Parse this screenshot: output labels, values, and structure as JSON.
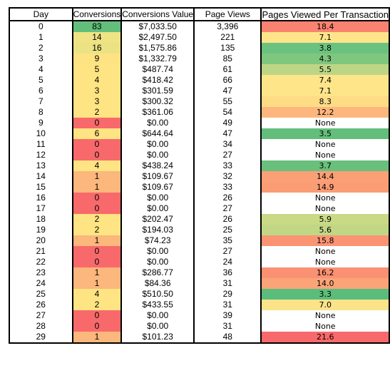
{
  "table": {
    "headers": {
      "day": "Day",
      "conversions": "Conversions",
      "conversions_value": "Conversions Value",
      "page_views": "Page Views",
      "pages_per_transaction": "Pages Viewed Per Transaction"
    },
    "rows": [
      {
        "day": "0",
        "conversions": "83",
        "conversions_value": "$7,033.50",
        "page_views": "3,396",
        "pages_per_transaction": "18.4",
        "conv_color": "#63be7b",
        "ppt_color": "#f98370"
      },
      {
        "day": "1",
        "conversions": "14",
        "conversions_value": "$2,497.50",
        "page_views": "221",
        "pages_per_transaction": "7.1",
        "conv_color": "#efe383",
        "ppt_color": "#ffe58a"
      },
      {
        "day": "2",
        "conversions": "16",
        "conversions_value": "$1,575.86",
        "page_views": "135",
        "pages_per_transaction": "3.8",
        "conv_color": "#ebe283",
        "ppt_color": "#6bc27e"
      },
      {
        "day": "3",
        "conversions": "9",
        "conversions_value": "$1,332.79",
        "page_views": "85",
        "pages_per_transaction": "4.3",
        "conv_color": "#fee383",
        "ppt_color": "#7fc67f"
      },
      {
        "day": "4",
        "conversions": "5",
        "conversions_value": "$487.74",
        "page_views": "61",
        "pages_per_transaction": "5.5",
        "conv_color": "#fee482",
        "ppt_color": "#bcd686"
      },
      {
        "day": "5",
        "conversions": "4",
        "conversions_value": "$418.42",
        "page_views": "66",
        "pages_per_transaction": "7.4",
        "conv_color": "#fee482",
        "ppt_color": "#ffe58a"
      },
      {
        "day": "6",
        "conversions": "3",
        "conversions_value": "$301.59",
        "page_views": "47",
        "pages_per_transaction": "7.1",
        "conv_color": "#fee482",
        "ppt_color": "#ffe58a"
      },
      {
        "day": "7",
        "conversions": "3",
        "conversions_value": "$300.32",
        "page_views": "55",
        "pages_per_transaction": "8.3",
        "conv_color": "#fee482",
        "ppt_color": "#fedc86"
      },
      {
        "day": "8",
        "conversions": "2",
        "conversions_value": "$361.06",
        "page_views": "54",
        "pages_per_transaction": "12.2",
        "conv_color": "#fee482",
        "ppt_color": "#fdb77e"
      },
      {
        "day": "9",
        "conversions": "0",
        "conversions_value": "$0.00",
        "page_views": "49",
        "pages_per_transaction": "None",
        "conv_color": "#f8696b",
        "ppt_color": "#ffffff"
      },
      {
        "day": "10",
        "conversions": "6",
        "conversions_value": "$644.64",
        "page_views": "47",
        "pages_per_transaction": "3.5",
        "conv_color": "#fee482",
        "ppt_color": "#63be7b"
      },
      {
        "day": "11",
        "conversions": "0",
        "conversions_value": "$0.00",
        "page_views": "34",
        "pages_per_transaction": "None",
        "conv_color": "#f8696b",
        "ppt_color": "#ffffff"
      },
      {
        "day": "12",
        "conversions": "0",
        "conversions_value": "$0.00",
        "page_views": "27",
        "pages_per_transaction": "None",
        "conv_color": "#f8696b",
        "ppt_color": "#ffffff"
      },
      {
        "day": "13",
        "conversions": "4",
        "conversions_value": "$438.24",
        "page_views": "33",
        "pages_per_transaction": "3.7",
        "conv_color": "#fee482",
        "ppt_color": "#69c07c"
      },
      {
        "day": "14",
        "conversions": "1",
        "conversions_value": "$109.67",
        "page_views": "32",
        "pages_per_transaction": "14.4",
        "conv_color": "#fbb77c",
        "ppt_color": "#fba076"
      },
      {
        "day": "15",
        "conversions": "1",
        "conversions_value": "$109.67",
        "page_views": "33",
        "pages_per_transaction": "14.9",
        "conv_color": "#fbb77c",
        "ppt_color": "#fb9c75"
      },
      {
        "day": "16",
        "conversions": "0",
        "conversions_value": "$0.00",
        "page_views": "26",
        "pages_per_transaction": "None",
        "conv_color": "#f8696b",
        "ppt_color": "#ffffff"
      },
      {
        "day": "17",
        "conversions": "0",
        "conversions_value": "$0.00",
        "page_views": "27",
        "pages_per_transaction": "None",
        "conv_color": "#f8696b",
        "ppt_color": "#ffffff"
      },
      {
        "day": "18",
        "conversions": "2",
        "conversions_value": "$202.47",
        "page_views": "26",
        "pages_per_transaction": "5.9",
        "conv_color": "#fee482",
        "ppt_color": "#c9d986"
      },
      {
        "day": "19",
        "conversions": "2",
        "conversions_value": "$194.03",
        "page_views": "25",
        "pages_per_transaction": "5.6",
        "conv_color": "#fee482",
        "ppt_color": "#c1d785"
      },
      {
        "day": "20",
        "conversions": "1",
        "conversions_value": "$74.23",
        "page_views": "35",
        "pages_per_transaction": "15.8",
        "conv_color": "#fbb77c",
        "ppt_color": "#fa9473"
      },
      {
        "day": "21",
        "conversions": "0",
        "conversions_value": "$0.00",
        "page_views": "27",
        "pages_per_transaction": "None",
        "conv_color": "#f8696b",
        "ppt_color": "#ffffff"
      },
      {
        "day": "22",
        "conversions": "0",
        "conversions_value": "$0.00",
        "page_views": "24",
        "pages_per_transaction": "None",
        "conv_color": "#f8696b",
        "ppt_color": "#ffffff"
      },
      {
        "day": "23",
        "conversions": "1",
        "conversions_value": "$286.77",
        "page_views": "36",
        "pages_per_transaction": "16.2",
        "conv_color": "#fbb77c",
        "ppt_color": "#fa9173"
      },
      {
        "day": "24",
        "conversions": "1",
        "conversions_value": "$84.36",
        "page_views": "31",
        "pages_per_transaction": "14.0",
        "conv_color": "#fbb77c",
        "ppt_color": "#fba477"
      },
      {
        "day": "25",
        "conversions": "4",
        "conversions_value": "$510.50",
        "page_views": "29",
        "pages_per_transaction": "3.3",
        "conv_color": "#fee482",
        "ppt_color": "#5bbd7b"
      },
      {
        "day": "26",
        "conversions": "2",
        "conversions_value": "$433.55",
        "page_views": "31",
        "pages_per_transaction": "7.0",
        "conv_color": "#fee482",
        "ppt_color": "#fbe38a"
      },
      {
        "day": "27",
        "conversions": "0",
        "conversions_value": "$0.00",
        "page_views": "39",
        "pages_per_transaction": "None",
        "conv_color": "#f8696b",
        "ppt_color": "#ffffff"
      },
      {
        "day": "28",
        "conversions": "0",
        "conversions_value": "$0.00",
        "page_views": "31",
        "pages_per_transaction": "None",
        "conv_color": "#f8696b",
        "ppt_color": "#ffffff"
      },
      {
        "day": "29",
        "conversions": "1",
        "conversions_value": "$101.23",
        "page_views": "48",
        "pages_per_transaction": "21.6",
        "conv_color": "#fbb77c",
        "ppt_color": "#f8696b"
      }
    ]
  }
}
